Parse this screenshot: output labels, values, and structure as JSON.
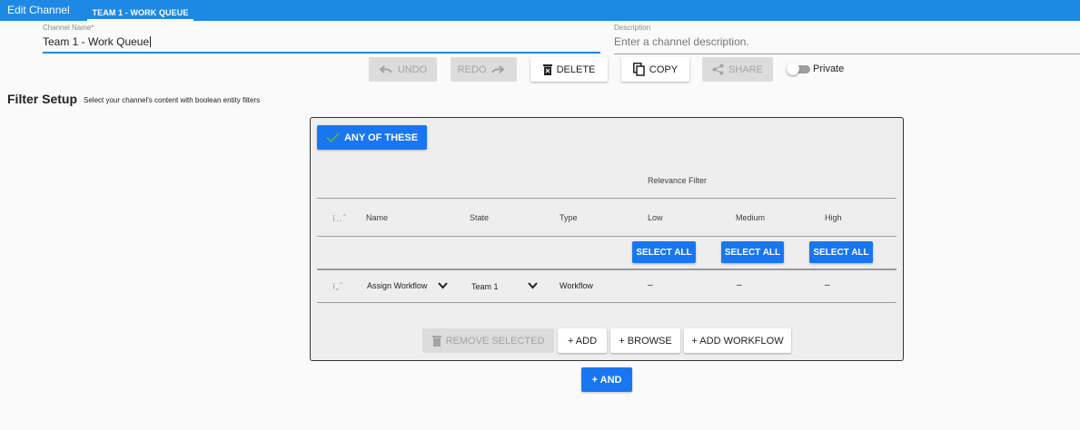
{
  "header": {
    "title": "Edit Channel",
    "active_tab": "TEAM 1 - WORK QUEUE"
  },
  "form": {
    "channel_name_label": "Channel Name*",
    "channel_name_value": "Team 1 - Work Queue",
    "description_label": "Description",
    "description_placeholder": "Enter a channel description."
  },
  "toolbar": {
    "undo": "UNDO",
    "redo": "REDO",
    "delete": "DELETE",
    "copy": "COPY",
    "share": "SHARE",
    "private_label": "Private",
    "private_on": false
  },
  "filter_setup": {
    "title": "Filter Setup",
    "subtitle": "Select your channel's content with boolean entity filters"
  },
  "filter_group": {
    "operator_button": "ANY OF THESE",
    "relevance_header": "Relevance Filter",
    "columns": {
      "drag": "ï‥ˆ",
      "name": "Name",
      "state": "State",
      "type": "Type",
      "low": "Low",
      "medium": "Medium",
      "high": "High"
    },
    "select_all": "SELECT ALL",
    "rows": [
      {
        "drag": "ï„ˆ",
        "name": "Assign Workflow",
        "state": "Team 1",
        "type": "Workflow",
        "low": "–",
        "medium": "–",
        "high": "–"
      }
    ],
    "actions": {
      "remove_selected": "REMOVE SELECTED",
      "add": "+ ADD",
      "browse": "+ BROWSE",
      "add_workflow": "+ ADD WORKFLOW"
    }
  },
  "and_button": "+ AND",
  "colors": {
    "primary": "#1e88e5",
    "button_blue": "#1976f0",
    "check_green": "#4caf50"
  }
}
